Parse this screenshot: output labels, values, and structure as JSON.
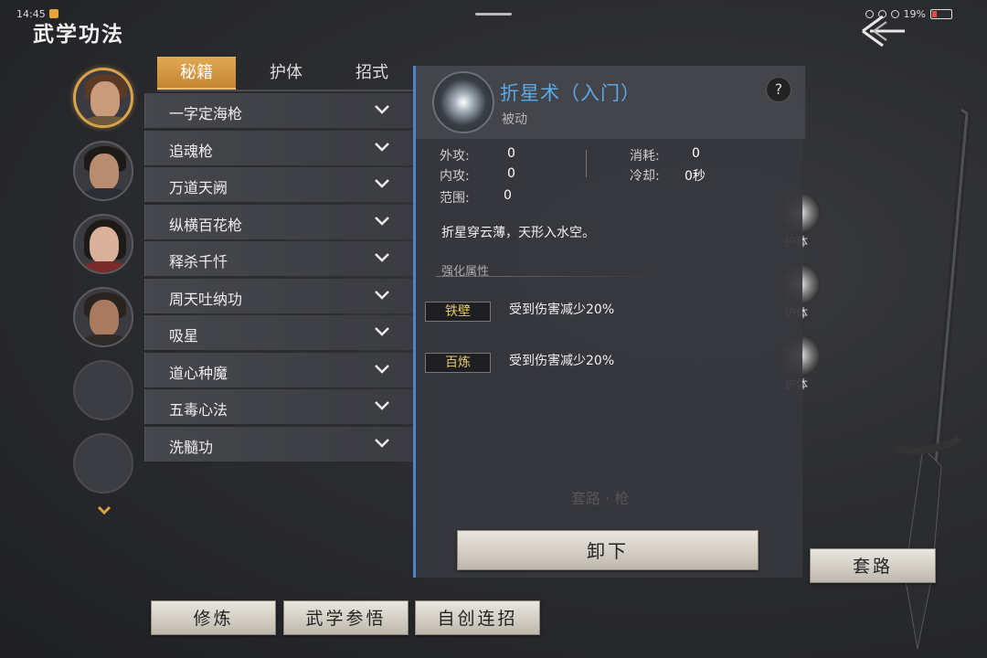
{
  "status": {
    "time": "14:45",
    "battery": "19%"
  },
  "page_title": "武学功法",
  "tabs": [
    {
      "label": "秘籍",
      "active": true
    },
    {
      "label": "护体",
      "active": false
    },
    {
      "label": "招式",
      "active": false
    }
  ],
  "skills": [
    "一字定海枪",
    "追魂枪",
    "万道天阙",
    "纵横百花枪",
    "释杀千忏",
    "周天吐纳功",
    "吸星",
    "道心种魔",
    "五毒心法",
    "洗髓功"
  ],
  "detail": {
    "name": "折星术（入门）",
    "type": "被动",
    "help": "?",
    "stats": {
      "outer_attack_label": "外攻:",
      "outer_attack": "0",
      "inner_attack_label": "内攻:",
      "inner_attack": "0",
      "range_label": "范围:",
      "range": "0",
      "cost_label": "消耗:",
      "cost": "0",
      "cooldown_label": "冷却:",
      "cooldown": "0秒"
    },
    "description": "折星穿云薄，天形入水空。",
    "enhance_title": "强化属性",
    "enhancements": [
      {
        "tag": "铁壁",
        "text": "受到伤害减少20%"
      },
      {
        "tag": "百炼",
        "text": "受到伤害减少20%"
      }
    ]
  },
  "buttons": {
    "unequip": "卸下",
    "taolu": "套路",
    "practice": "修炼",
    "insight": "武学参悟",
    "combo": "自创连招"
  },
  "background": {
    "side_labels": [
      "护体",
      "护体",
      "护体"
    ],
    "faint_text": "套路 · 枪"
  }
}
